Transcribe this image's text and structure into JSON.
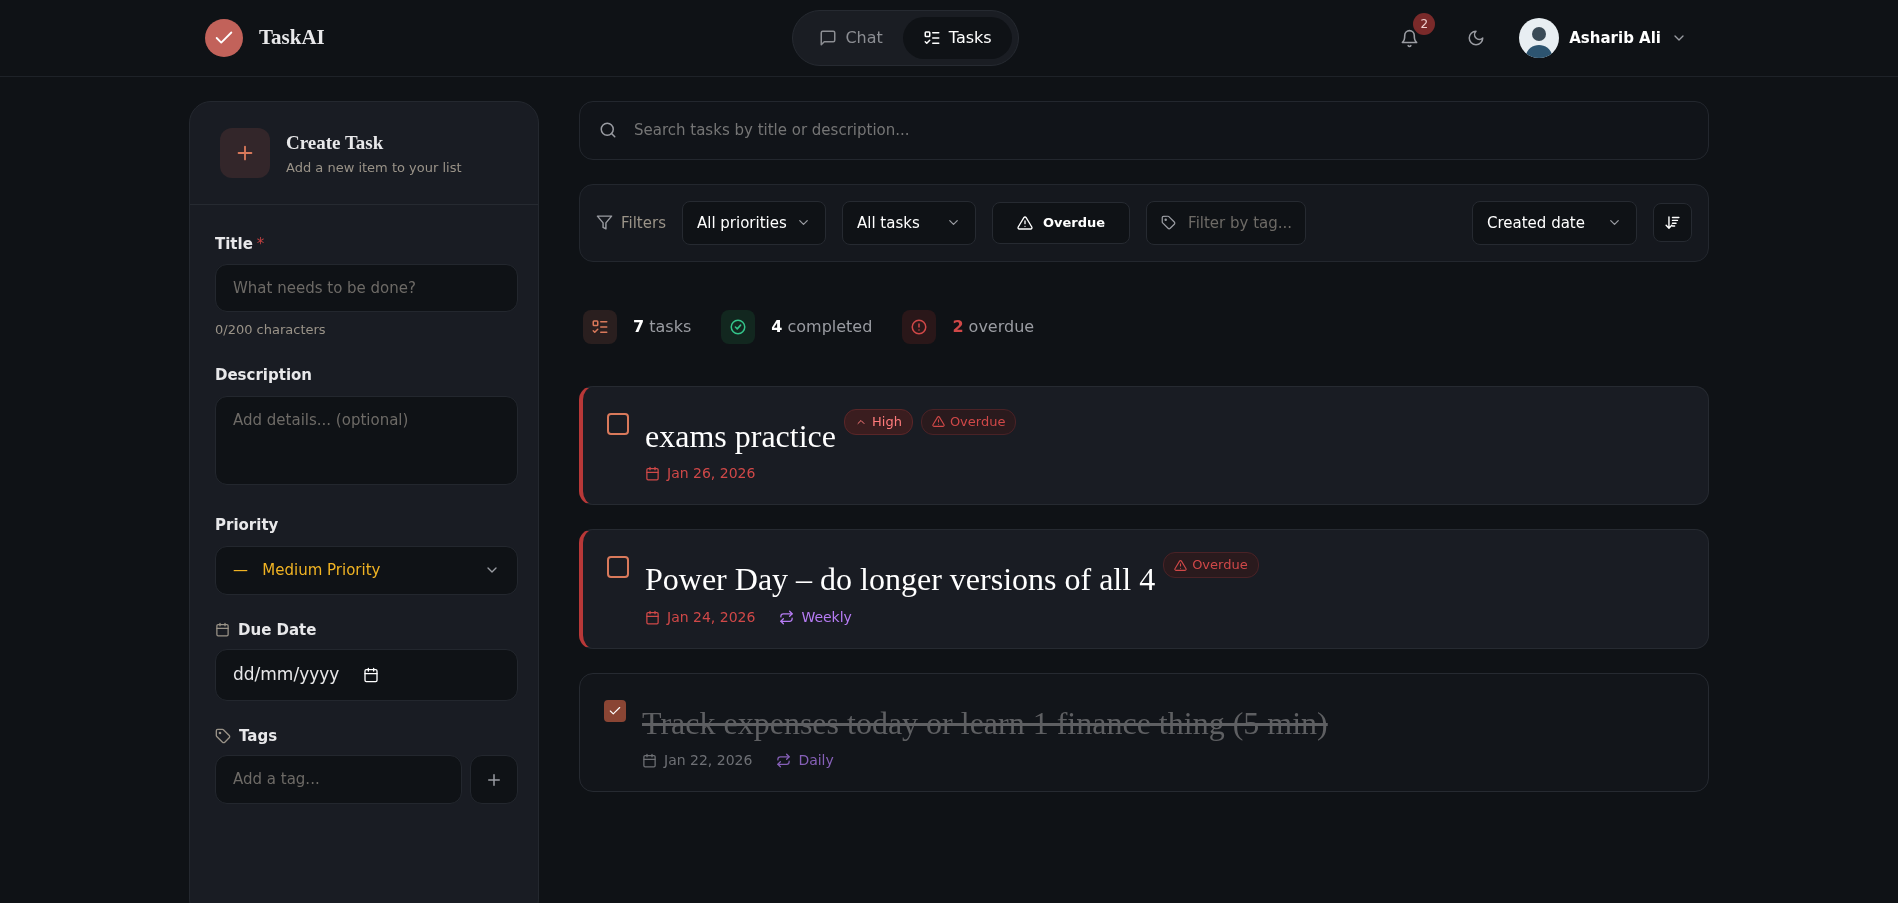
{
  "header": {
    "brand": "TaskAI",
    "tabs": [
      {
        "label": "Chat",
        "selected": false
      },
      {
        "label": "Tasks",
        "selected": true
      }
    ],
    "notification_count": "2",
    "user_name": "Asharib Ali"
  },
  "create_task": {
    "title": "Create Task",
    "subtitle": "Add a new item to your list",
    "title_label": "Title",
    "required_mark": "*",
    "title_placeholder": "What needs to be done?",
    "char_count": "0/200 characters",
    "description_label": "Description",
    "description_placeholder": "Add details... (optional)",
    "priority_label": "Priority",
    "priority_symbol": "—",
    "priority_value": "Medium Priority",
    "due_label": "Due Date",
    "due_value": "dd/mm/yyyy",
    "tags_label": "Tags",
    "tag_placeholder": "Add a tag..."
  },
  "search": {
    "placeholder": "Search tasks by title or description..."
  },
  "filters": {
    "label": "Filters",
    "priority": "All priorities",
    "status": "All tasks",
    "overdue_button": "Overdue",
    "overdue_active": false,
    "tag_placeholder": "Filter by tag...",
    "sort": "Created date"
  },
  "stats": [
    {
      "kind": "total",
      "count": "7",
      "label": "tasks"
    },
    {
      "kind": "completed",
      "count": "4",
      "label": "completed"
    },
    {
      "kind": "overdue",
      "count": "2",
      "label": "overdue"
    }
  ],
  "tasks": [
    {
      "title": "exams practice",
      "completed": false,
      "overdue": true,
      "priority": "High",
      "overdue_badge": "Overdue",
      "due": "Jan 26, 2026"
    },
    {
      "title": "Power Day – do longer versions of all 4",
      "completed": false,
      "overdue": true,
      "overdue_badge": "Overdue",
      "due": "Jan 24, 2026",
      "recurrence": "Weekly"
    },
    {
      "title": "Track expenses today or learn 1 finance thing (5 min)",
      "completed": true,
      "overdue": false,
      "due": "Jan 22, 2026",
      "recurrence": "Daily"
    }
  ]
}
